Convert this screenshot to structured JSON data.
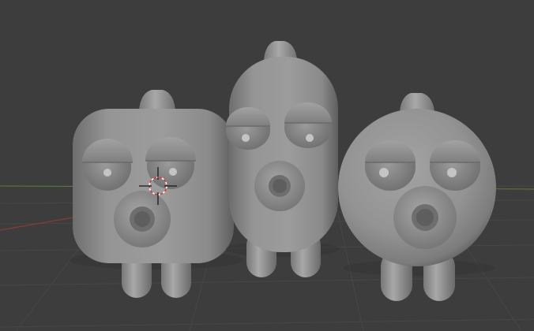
{
  "viewport": {
    "background": "#3d3d3d",
    "grid_color": "#474747",
    "x_axis_color": "#8c3a3a",
    "y_axis_color": "#5f7a37"
  },
  "scene": {
    "material_color": "#8e8e8e",
    "objects": [
      {
        "name": "square-character"
      },
      {
        "name": "capsule-character"
      },
      {
        "name": "round-character"
      }
    ],
    "cursor": "3d-cursor-icon"
  }
}
